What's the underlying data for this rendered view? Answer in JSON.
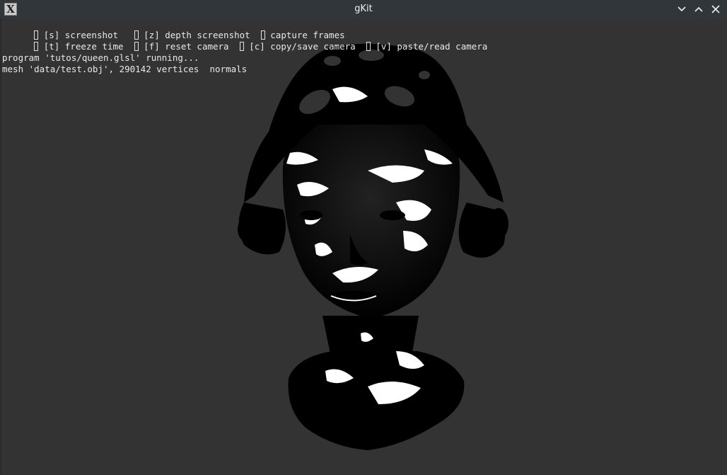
{
  "window": {
    "title": "gKit",
    "app_icon": "X",
    "controls": [
      "minimize-icon",
      "maximize-icon",
      "close-icon"
    ]
  },
  "options": {
    "row1": [
      {
        "label": "[s] screenshot",
        "checked": false
      },
      {
        "label": "[z] depth screenshot",
        "checked": false
      },
      {
        "label": "capture frames",
        "checked": false
      }
    ],
    "row2": [
      {
        "label": "[t] freeze time",
        "checked": false
      },
      {
        "label": "[f] reset camera",
        "checked": false
      },
      {
        "label": "[c] copy/save camera",
        "checked": false
      },
      {
        "label": "[v] paste/read camera",
        "checked": false
      }
    ]
  },
  "log": {
    "line1": "program 'tutos/queen.glsl' running...",
    "line2": "mesh 'data/test.obj', 290142 vertices  normals"
  },
  "colors": {
    "background": "#333333",
    "titlebar": "#31363b",
    "text": "#e9e9e9",
    "model": "#000000",
    "highlight": "#ffffff"
  }
}
